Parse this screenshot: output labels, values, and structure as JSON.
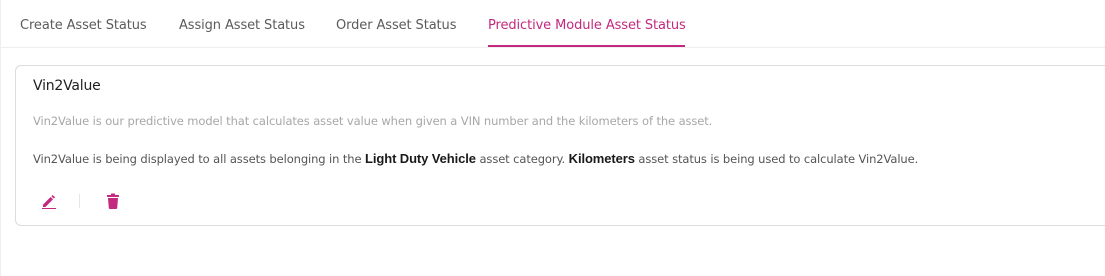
{
  "tabs": [
    {
      "label": "Create Asset Status",
      "active": false
    },
    {
      "label": "Assign Asset Status",
      "active": false
    },
    {
      "label": "Order Asset Status",
      "active": false
    },
    {
      "label": "Predictive Module Asset Status",
      "active": true
    }
  ],
  "card": {
    "title": "Vin2Value",
    "description": "Vin2Value is our predictive model that calculates asset value when given a VIN number and the kilometers of the asset.",
    "info": {
      "part1": "Vin2Value is being displayed to all assets belonging in the ",
      "category": "Light Duty Vehicle",
      "part2": " asset category. ",
      "status": "Kilometers",
      "part3": " asset status is being used to calculate Vin2Value."
    },
    "actions": {
      "edit_icon": "pencil-icon",
      "delete_icon": "trash-icon"
    }
  },
  "colors": {
    "accent": "#c2297f",
    "text": "#5b5b5b",
    "muted": "#a7a7a7",
    "border": "#dcdcdc"
  }
}
